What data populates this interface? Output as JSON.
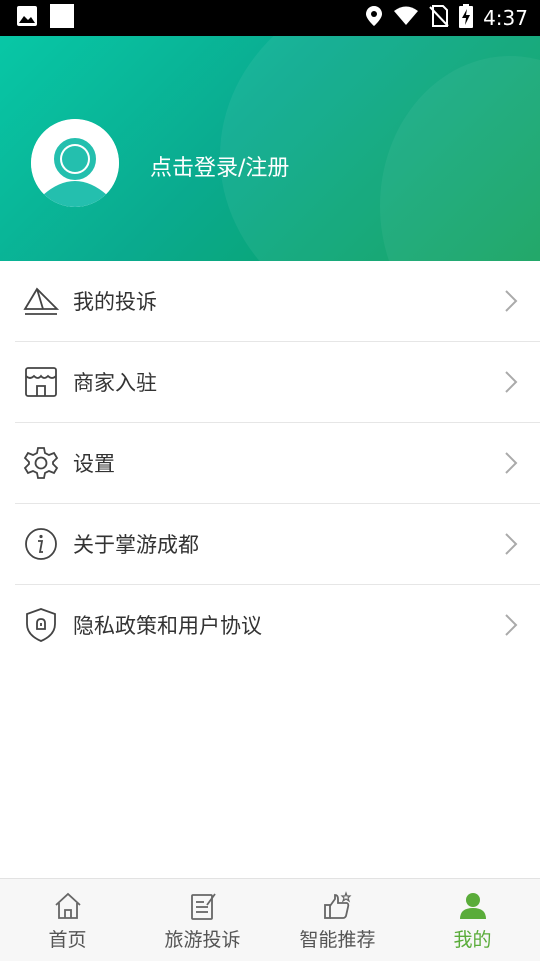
{
  "status_bar": {
    "time": "4:37",
    "icons": [
      "image-icon",
      "square-icon",
      "location-icon",
      "wifi-icon",
      "no-sim-icon",
      "battery-charging-icon"
    ]
  },
  "profile": {
    "login_text": "点击登录/注册",
    "avatar_icon": "user-avatar-icon"
  },
  "menu": {
    "items": [
      {
        "label": "我的投诉",
        "icon": "complaint-paper-plane-icon"
      },
      {
        "label": "商家入驻",
        "icon": "store-icon"
      },
      {
        "label": "设置",
        "icon": "gear-icon"
      },
      {
        "label": "关于掌游成都",
        "icon": "info-icon"
      },
      {
        "label": "隐私政策和用户协议",
        "icon": "shield-lock-icon"
      }
    ]
  },
  "bottom_nav": {
    "items": [
      {
        "label": "首页",
        "icon": "home-icon",
        "active": false
      },
      {
        "label": "旅游投诉",
        "icon": "edit-note-icon",
        "active": false
      },
      {
        "label": "智能推荐",
        "icon": "thumbs-up-icon",
        "active": false
      },
      {
        "label": "我的",
        "icon": "user-icon",
        "active": true
      }
    ]
  },
  "colors": {
    "header_gradient_start": "#08c7a6",
    "header_gradient_end": "#0a9f59",
    "active_nav": "#5aac3a",
    "avatar_teal": "#24bfae"
  }
}
